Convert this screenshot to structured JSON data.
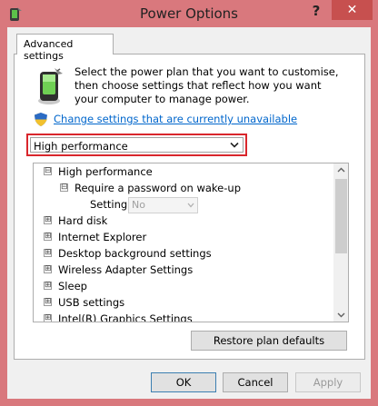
{
  "window": {
    "title": "Power Options",
    "help_label": "?",
    "close_label": "✕"
  },
  "tab": {
    "label": "Advanced settings"
  },
  "description": "Select the power plan that you want to customise, then choose settings that reflect how you want your computer to manage power.",
  "change_link": "Change settings that are currently unavailable",
  "plan_select": {
    "value": "High performance"
  },
  "tree": {
    "root": {
      "label": "High performance",
      "expander": "⊟"
    },
    "child": {
      "label": "Require a password on wake-up",
      "expander": "⊟"
    },
    "setting": {
      "label": "Setting:",
      "value": "No"
    },
    "items": [
      {
        "label": "Hard disk",
        "expander": "⊞"
      },
      {
        "label": "Internet Explorer",
        "expander": "⊞"
      },
      {
        "label": "Desktop background settings",
        "expander": "⊞"
      },
      {
        "label": "Wireless Adapter Settings",
        "expander": "⊞"
      },
      {
        "label": "Sleep",
        "expander": "⊞"
      },
      {
        "label": "USB settings",
        "expander": "⊞"
      },
      {
        "label": "Intel(R) Graphics Settings",
        "expander": "⊞"
      }
    ]
  },
  "buttons": {
    "restore": "Restore plan defaults",
    "ok": "OK",
    "cancel": "Cancel",
    "apply": "Apply"
  },
  "colors": {
    "window_frame": "#d9787d",
    "close_button": "#c7504f",
    "highlight_border": "#d9262c",
    "link": "#0066cc"
  }
}
